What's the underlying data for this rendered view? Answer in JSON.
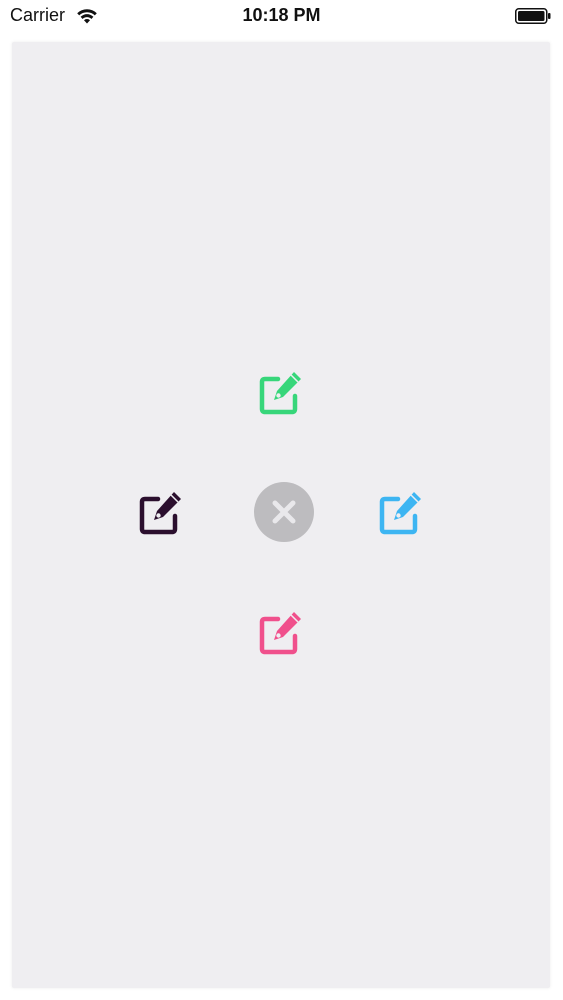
{
  "status_bar": {
    "carrier": "Carrier",
    "time": "10:18 PM",
    "wifi_icon": "wifi-icon",
    "battery_icon": "battery-icon"
  },
  "radial_menu": {
    "center_button": {
      "icon": "close-icon",
      "background_color": "#bdbcbf",
      "icon_color": "#e9e8eb"
    },
    "items": [
      {
        "position": "top",
        "icon": "edit-icon",
        "color": "#37d67a"
      },
      {
        "position": "left",
        "icon": "edit-icon",
        "color": "#2b0f2e"
      },
      {
        "position": "right",
        "icon": "edit-icon",
        "color": "#3db5f2"
      },
      {
        "position": "bottom",
        "icon": "edit-icon",
        "color": "#f0508c"
      }
    ]
  }
}
